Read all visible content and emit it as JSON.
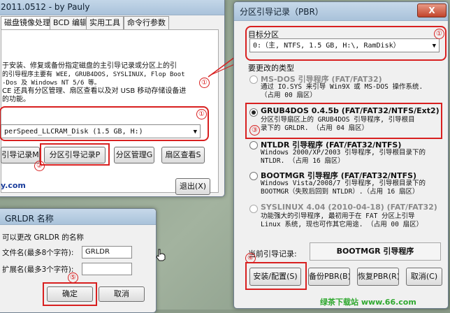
{
  "main_window": {
    "title": "2011.0512 - by Pauly",
    "tabs": [
      "磁盘镜像处理",
      "BCD 编辑",
      "实用工具",
      "命令行参数"
    ],
    "description": [
      "于安装、修复或备份指定磁盘的主引导记录或分区上的引",
      "的引导程序主要有 WEE, GRUB4DOS, SYSLINUX, Flop Boot",
      "-Dos 及 Windows NT 5/6 等。",
      "CE 还具有分区管理、扇区查看以及对 USB 移动存储设备进",
      "的功能。"
    ],
    "disk_select": "perSpeed_LLCRAM_Disk (1.5 GB, H:)",
    "buttons": {
      "mbr": "引导记录M",
      "pbr": "分区引导记录P",
      "partition": "分区管理G",
      "sector": "扇区查看S",
      "exit": "退出(X)"
    },
    "footer": "y.com",
    "markers": [
      "①",
      "①",
      "②"
    ]
  },
  "rename_dialog": {
    "title": "GRLDR 名称",
    "prompt": "可以更改 GRLDR 的名称",
    "file_label": "文件名(最多8个字符):",
    "file_value": "GRLDR",
    "ext_label": "扩展名(最多3个字符):",
    "ext_value": "",
    "ok": "确定",
    "cancel": "取消",
    "marker": "⑤"
  },
  "pbr_window": {
    "title": "分区引导记录（PBR）",
    "close": "X",
    "target_label": "目标分区",
    "target_value": "0:（主,  NTFS,    1.5 GB, H:\\, RamDisk）",
    "type_label": "要更改的类型",
    "options": [
      {
        "title": "MS-DOS 引导程序 (FAT/FAT32)",
        "desc": "通过 IO.SYS 来引导 Win9X 或 MS-DOS 操作系统.\n（占用 00 扇区）",
        "enabled": false,
        "selected": false
      },
      {
        "title": "GRUB4DOS 0.4.5b (FAT/FAT32/NTFS/Ext2)",
        "desc": "分区引导扇区上的 GRUB4DOS 引导程序, 引导根目\n录下的 GRLDR. （占用 04 扇区）",
        "enabled": true,
        "selected": true
      },
      {
        "title": "NTLDR 引导程序 (FAT/FAT32/NTFS)",
        "desc": "Windows 2000/XP/2003 引导程序, 引导根目录下的\nNTLDR. （占用 16 扇区）",
        "enabled": true,
        "selected": false
      },
      {
        "title": "BOOTMGR 引导程序 (FAT/FAT32/NTFS)",
        "desc": "Windows Vista/2008/7 引导程序, 引导根目录下的\nBOOTMGR（失败后回到 NTLDR）.（占用 16 扇区）",
        "enabled": true,
        "selected": false
      },
      {
        "title": "SYSLINUX 4.04 (2010-04-18) (FAT/FAT32)",
        "desc": "功能强大的引导程序, 最初用于在 FAT 分区上引导\nLinux 系统, 现也可作其它用途. （占用 00 扇区）",
        "enabled": false,
        "selected": false
      }
    ],
    "current_label": "当前引导记录:",
    "current_value": "BOOTMGR 引导程序",
    "buttons": {
      "install": "安装/配置(S)",
      "backup": "备份PBR(B)",
      "restore": "恢复PBR(R)",
      "cancel": "取消(C)"
    },
    "markers": [
      "①",
      "③",
      "④"
    ]
  },
  "watermark": "绿茶下载站 www.66.com"
}
